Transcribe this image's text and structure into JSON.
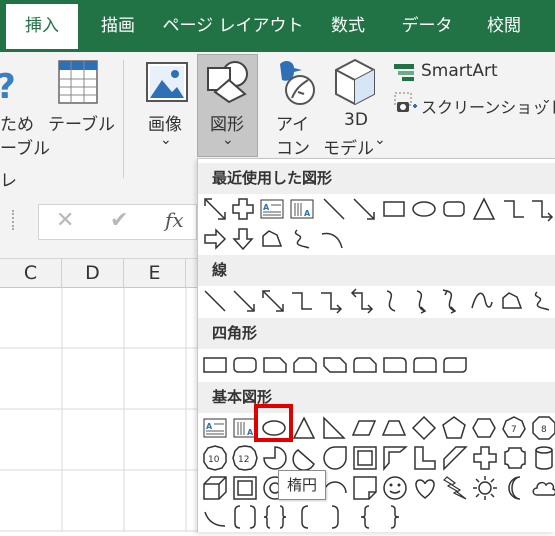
{
  "tabs": [
    "挿入",
    "描画",
    "ページ レイアウト",
    "数式",
    "データ",
    "校閲"
  ],
  "ribbon": {
    "rec_table_line1": "ため",
    "rec_table_line2": "ーブル",
    "rec_table_line3": "レ",
    "table": "テーブル",
    "image": "画像",
    "image_chev": "⌄",
    "shapes": "図形",
    "shapes_chev": "⌄",
    "icons_line1": "アイ",
    "icons_line2": "コン",
    "model_line1": "3D",
    "model_line2": "モデル",
    "model_chev": "⌄",
    "smartart": "SmartArt",
    "screenshot": "スクリーンショット",
    "screenshot_chev": "⌄"
  },
  "formula": {
    "cancel": "✕",
    "enter": "✔",
    "fx": "fx"
  },
  "columns": [
    "C",
    "D",
    "E"
  ],
  "dropdown": {
    "recent": "最近使用した図形",
    "lines": "線",
    "rect": "四角形",
    "basic": "基本図形"
  },
  "tooltip": "楕円",
  "colors": {
    "accent": "#217346",
    "highlight": "#e00000"
  }
}
